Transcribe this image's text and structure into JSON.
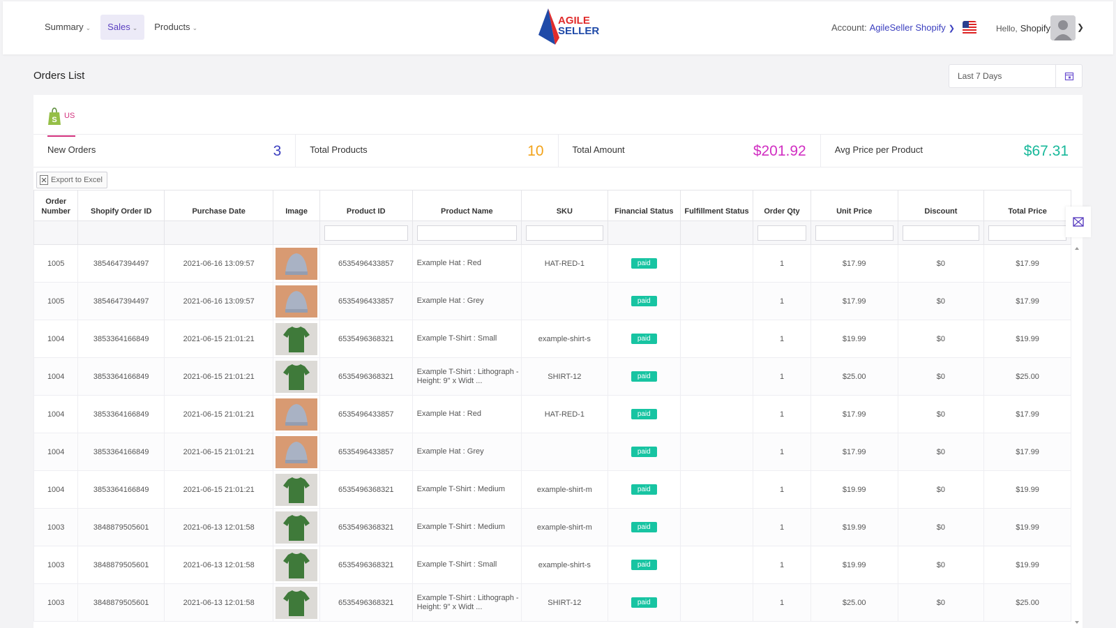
{
  "nav": {
    "items": [
      {
        "label": "Summary",
        "active": false
      },
      {
        "label": "Sales",
        "active": true
      },
      {
        "label": "Products",
        "active": false
      }
    ]
  },
  "logo": {
    "line1": "AGILE",
    "line2": "SELLER"
  },
  "account": {
    "label": "Account:",
    "value": "AgileSeller Shopify"
  },
  "user": {
    "hello": "Hello,",
    "name": "Shopify"
  },
  "page": {
    "title": "Orders List",
    "date_range": "Last 7 Days"
  },
  "tabs": [
    {
      "label": "US"
    }
  ],
  "stats": [
    {
      "label": "New Orders",
      "value": "3",
      "color": "#3b3fbf"
    },
    {
      "label": "Total Products",
      "value": "10",
      "color": "#f2a31b"
    },
    {
      "label": "Total Amount",
      "value": "$201.92",
      "color": "#d12fc2"
    },
    {
      "label": "Avg Price per Product",
      "value": "$67.31",
      "color": "#17b89a"
    }
  ],
  "export_label": "Export to Excel",
  "table": {
    "headers": [
      "Order Number",
      "Shopify Order ID",
      "Purchase Date",
      "Image",
      "Product ID",
      "Product Name",
      "SKU",
      "Financial Status",
      "Fulfillment Status",
      "Order Qty",
      "Unit Price",
      "Discount",
      "Total Price"
    ],
    "rows": [
      {
        "order": "1005",
        "shopify_id": "3854647394497",
        "date": "2021-06-16 13:09:57",
        "image": "hat",
        "product_id": "6535496433857",
        "name": "Example Hat : Red",
        "sku": "HAT-RED-1",
        "financial": "paid",
        "fulfillment": "",
        "qty": "1",
        "unit": "$17.99",
        "discount": "$0",
        "total": "$17.99"
      },
      {
        "order": "1005",
        "shopify_id": "3854647394497",
        "date": "2021-06-16 13:09:57",
        "image": "hat",
        "product_id": "6535496433857",
        "name": "Example Hat : Grey",
        "sku": "",
        "financial": "paid",
        "fulfillment": "",
        "qty": "1",
        "unit": "$17.99",
        "discount": "$0",
        "total": "$17.99"
      },
      {
        "order": "1004",
        "shopify_id": "3853364166849",
        "date": "2021-06-15 21:01:21",
        "image": "shirt",
        "product_id": "6535496368321",
        "name": "Example T-Shirt : Small",
        "sku": "example-shirt-s",
        "financial": "paid",
        "fulfillment": "",
        "qty": "1",
        "unit": "$19.99",
        "discount": "$0",
        "total": "$19.99"
      },
      {
        "order": "1004",
        "shopify_id": "3853364166849",
        "date": "2021-06-15 21:01:21",
        "image": "shirt",
        "product_id": "6535496368321",
        "name": "Example T-Shirt : Lithograph - Height: 9\" x Widt ...",
        "sku": "SHIRT-12",
        "financial": "paid",
        "fulfillment": "",
        "qty": "1",
        "unit": "$25.00",
        "discount": "$0",
        "total": "$25.00"
      },
      {
        "order": "1004",
        "shopify_id": "3853364166849",
        "date": "2021-06-15 21:01:21",
        "image": "hat",
        "product_id": "6535496433857",
        "name": "Example Hat : Red",
        "sku": "HAT-RED-1",
        "financial": "paid",
        "fulfillment": "",
        "qty": "1",
        "unit": "$17.99",
        "discount": "$0",
        "total": "$17.99"
      },
      {
        "order": "1004",
        "shopify_id": "3853364166849",
        "date": "2021-06-15 21:01:21",
        "image": "hat",
        "product_id": "6535496433857",
        "name": "Example Hat : Grey",
        "sku": "",
        "financial": "paid",
        "fulfillment": "",
        "qty": "1",
        "unit": "$17.99",
        "discount": "$0",
        "total": "$17.99"
      },
      {
        "order": "1004",
        "shopify_id": "3853364166849",
        "date": "2021-06-15 21:01:21",
        "image": "shirt",
        "product_id": "6535496368321",
        "name": "Example T-Shirt : Medium",
        "sku": "example-shirt-m",
        "financial": "paid",
        "fulfillment": "",
        "qty": "1",
        "unit": "$19.99",
        "discount": "$0",
        "total": "$19.99"
      },
      {
        "order": "1003",
        "shopify_id": "3848879505601",
        "date": "2021-06-13 12:01:58",
        "image": "shirt",
        "product_id": "6535496368321",
        "name": "Example T-Shirt : Medium",
        "sku": "example-shirt-m",
        "financial": "paid",
        "fulfillment": "",
        "qty": "1",
        "unit": "$19.99",
        "discount": "$0",
        "total": "$19.99"
      },
      {
        "order": "1003",
        "shopify_id": "3848879505601",
        "date": "2021-06-13 12:01:58",
        "image": "shirt",
        "product_id": "6535496368321",
        "name": "Example T-Shirt : Small",
        "sku": "example-shirt-s",
        "financial": "paid",
        "fulfillment": "",
        "qty": "1",
        "unit": "$19.99",
        "discount": "$0",
        "total": "$19.99"
      },
      {
        "order": "1003",
        "shopify_id": "3848879505601",
        "date": "2021-06-13 12:01:58",
        "image": "shirt",
        "product_id": "6535496368321",
        "name": "Example T-Shirt : Lithograph - Height: 9\" x Widt ...",
        "sku": "SHIRT-12",
        "financial": "paid",
        "fulfillment": "",
        "qty": "1",
        "unit": "$25.00",
        "discount": "$0",
        "total": "$25.00"
      }
    ]
  },
  "colors": {
    "accent": "#5a3fc0",
    "badge": "#17c4a2",
    "tab": "#d2317d"
  }
}
